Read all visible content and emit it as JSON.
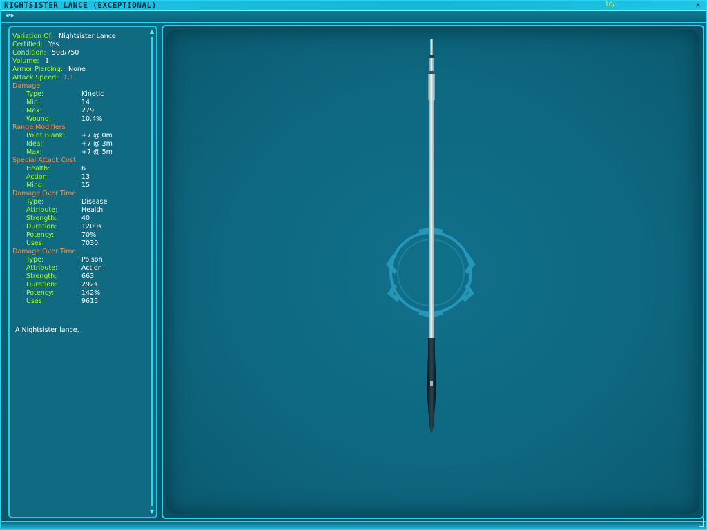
{
  "window": {
    "title": "NIGHTSISTER LANCE (EXCEPTIONAL)",
    "badge": "10/",
    "close_glyph": "×"
  },
  "subbar": {
    "arrows": "◂•▸"
  },
  "colors": {
    "label": "#a6ff2e",
    "value": "#ffffff",
    "section": "#ff8a3c",
    "frame": "#29d4f0"
  },
  "attributes": [
    {
      "label": "Variation Of:",
      "value": "Nightsister Lance",
      "type": "field",
      "indent": 0,
      "val_col": 1
    },
    {
      "label": "Certified:",
      "value": "Yes",
      "type": "field",
      "indent": 0,
      "val_col": 1
    },
    {
      "label": "Condition:",
      "value": "508/750",
      "type": "field",
      "indent": 0,
      "val_col": 1
    },
    {
      "label": "Volume:",
      "value": "1",
      "type": "field",
      "indent": 0,
      "val_col": 1
    },
    {
      "label": "Armor Piercing:",
      "value": "None",
      "type": "field",
      "indent": 0,
      "val_col": 1
    },
    {
      "label": "Attack Speed:",
      "value": "1.1",
      "type": "field",
      "indent": 0,
      "val_col": 1
    },
    {
      "label": "Damage",
      "value": "",
      "type": "section",
      "indent": 0
    },
    {
      "label": "Type:",
      "value": "Kinetic",
      "type": "field",
      "indent": 1
    },
    {
      "label": "Min:",
      "value": "14",
      "type": "field",
      "indent": 1
    },
    {
      "label": "Max:",
      "value": "279",
      "type": "field",
      "indent": 1
    },
    {
      "label": "Wound:",
      "value": "10.4%",
      "type": "field",
      "indent": 1
    },
    {
      "label": "Range Modifiers",
      "value": "",
      "type": "section",
      "indent": 0
    },
    {
      "label": "Point Blank:",
      "value": "+7  @  0m",
      "type": "field",
      "indent": 1
    },
    {
      "label": "Ideal:",
      "value": "+7  @  3m",
      "type": "field",
      "indent": 1
    },
    {
      "label": "Max:",
      "value": "+7  @  5m",
      "type": "field",
      "indent": 1
    },
    {
      "label": "Special Attack Cost",
      "value": "",
      "type": "section",
      "indent": 0
    },
    {
      "label": "Health:",
      "value": "6",
      "type": "field",
      "indent": 1
    },
    {
      "label": "Action:",
      "value": "13",
      "type": "field",
      "indent": 1
    },
    {
      "label": "Mind:",
      "value": "15",
      "type": "field",
      "indent": 1
    },
    {
      "label": "Damage Over Time",
      "value": "",
      "type": "section",
      "indent": 0
    },
    {
      "label": "Type:",
      "value": "Disease",
      "type": "field",
      "indent": 1
    },
    {
      "label": "Attribute:",
      "value": "Health",
      "type": "field",
      "indent": 1
    },
    {
      "label": "Strength:",
      "value": "40",
      "type": "field",
      "indent": 1
    },
    {
      "label": "Duration:",
      "value": "1200s",
      "type": "field",
      "indent": 1
    },
    {
      "label": "Potency:",
      "value": "70%",
      "type": "field",
      "indent": 1
    },
    {
      "label": "Uses:",
      "value": "7030",
      "type": "field",
      "indent": 1
    },
    {
      "label": "Damage Over Time",
      "value": "",
      "type": "section",
      "indent": 0
    },
    {
      "label": "Type:",
      "value": "Poison",
      "type": "field",
      "indent": 1
    },
    {
      "label": "Attribute:",
      "value": "Action",
      "type": "field",
      "indent": 1
    },
    {
      "label": "Strength:",
      "value": "663",
      "type": "field",
      "indent": 1
    },
    {
      "label": "Duration:",
      "value": "292s",
      "type": "field",
      "indent": 1
    },
    {
      "label": "Potency:",
      "value": "142%",
      "type": "field",
      "indent": 1
    },
    {
      "label": "Uses:",
      "value": "9615",
      "type": "field",
      "indent": 1
    }
  ],
  "description": "A Nightsister lance.",
  "viewer": {
    "item": "nightsister-lance"
  }
}
